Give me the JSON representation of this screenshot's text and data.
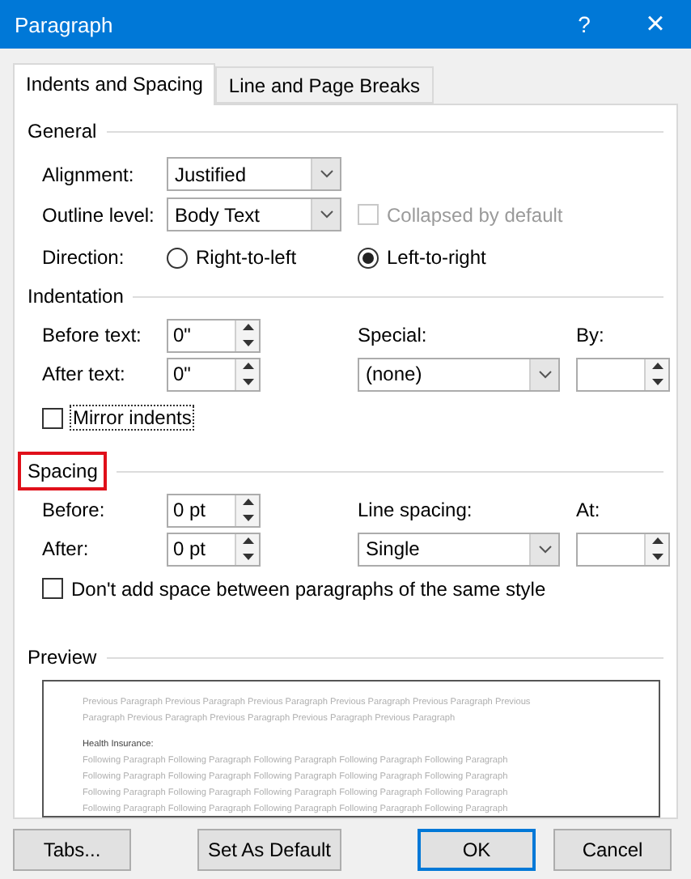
{
  "window": {
    "title": "Paragraph",
    "help": "?",
    "close": "×"
  },
  "tabs": [
    {
      "label": "Indents and Spacing",
      "selected": true
    },
    {
      "label": "Line and Page Breaks",
      "selected": false
    }
  ],
  "general": {
    "heading": "General",
    "alignment": {
      "label": "Alignment:",
      "value": "Justified"
    },
    "outline_level": {
      "label": "Outline level:",
      "value": "Body Text"
    },
    "collapsed": {
      "label": "Collapsed by default",
      "checked": false,
      "disabled": true
    },
    "direction": {
      "label": "Direction:",
      "options": [
        {
          "label": "Right-to-left",
          "selected": false
        },
        {
          "label": "Left-to-right",
          "selected": true
        }
      ]
    }
  },
  "indentation": {
    "heading": "Indentation",
    "before_text": {
      "label": "Before text:",
      "value": "0\""
    },
    "after_text": {
      "label": "After text:",
      "value": "0\""
    },
    "special": {
      "label": "Special:",
      "value": "(none)"
    },
    "by": {
      "label": "By:"
    },
    "mirror": {
      "label": "Mirror indents",
      "checked": false
    }
  },
  "spacing": {
    "heading": "Spacing",
    "highlighted": true,
    "before": {
      "label": "Before:",
      "value": "0 pt"
    },
    "after": {
      "label": "After:",
      "value": "0 pt"
    },
    "line_spacing": {
      "label": "Line spacing:",
      "value": "Single"
    },
    "at": {
      "label": "At:"
    },
    "dont_add": {
      "label": "Don't add space between paragraphs of the same style",
      "checked": false
    }
  },
  "preview": {
    "heading": "Preview",
    "previous": [
      "Previous Paragraph Previous Paragraph Previous Paragraph Previous Paragraph Previous Paragraph Previous",
      "Paragraph Previous Paragraph Previous Paragraph Previous Paragraph Previous Paragraph"
    ],
    "current": "Health Insurance:",
    "following": [
      "Following Paragraph Following Paragraph Following Paragraph Following Paragraph Following Paragraph",
      "Following Paragraph Following Paragraph Following Paragraph Following Paragraph Following Paragraph",
      "Following Paragraph Following Paragraph Following Paragraph Following Paragraph Following Paragraph",
      "Following Paragraph Following Paragraph Following Paragraph Following Paragraph Following Paragraph"
    ]
  },
  "buttons": [
    {
      "label": "Tabs...",
      "kind": "normal"
    },
    {
      "label": "Set As Default",
      "kind": "normal"
    },
    {
      "label": "OK",
      "kind": "default"
    },
    {
      "label": "Cancel",
      "kind": "normal"
    }
  ]
}
